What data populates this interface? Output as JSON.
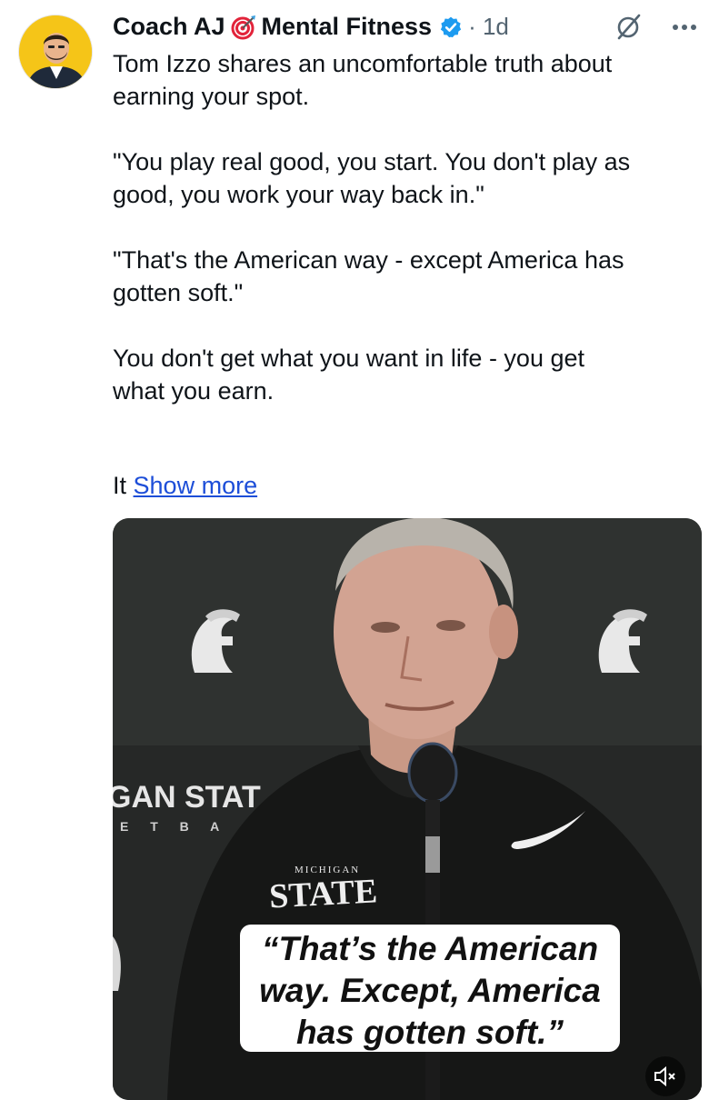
{
  "post": {
    "author_name": "Coach AJ",
    "author_name_suffix": "Mental Fitness",
    "time": "· 1d",
    "text": "Tom Izzo shares an uncomfortable truth about\nearning your spot.\n\n\"You play real good, you start. You don't play as\ngood, you work your way back in.\"\n\n\"That's the American way - except America has\ngotten soft.\"\n\nYou don't get what you want in life - you get\nwhat you earn.",
    "truncated_prefix": "It",
    "show_more_label": "Show more"
  },
  "media": {
    "sign_text": "GAN STAT",
    "sign_subtext": "E T B A",
    "shirt_logo_top": "MICHIGAN",
    "shirt_logo_main": "STATE",
    "caption_lines": [
      "“That’s the American",
      "way. Except, America",
      "has gotten soft.”"
    ]
  },
  "icons": {
    "verified": "verified-badge-icon",
    "target": "target-emoji-icon",
    "grok": "grok-icon",
    "more": "more-options-icon",
    "mute": "muted-speaker-icon",
    "spartan": "spartan-helmet-logo-icon",
    "swoosh": "swoosh-logo-icon"
  },
  "colors": {
    "verified_blue": "#1d9bf0",
    "link": "#1d4ed8",
    "text": "#0f1419",
    "muted": "#536471",
    "avatar_bg": "#f5c518",
    "video_bg": "#2b2d2c"
  }
}
